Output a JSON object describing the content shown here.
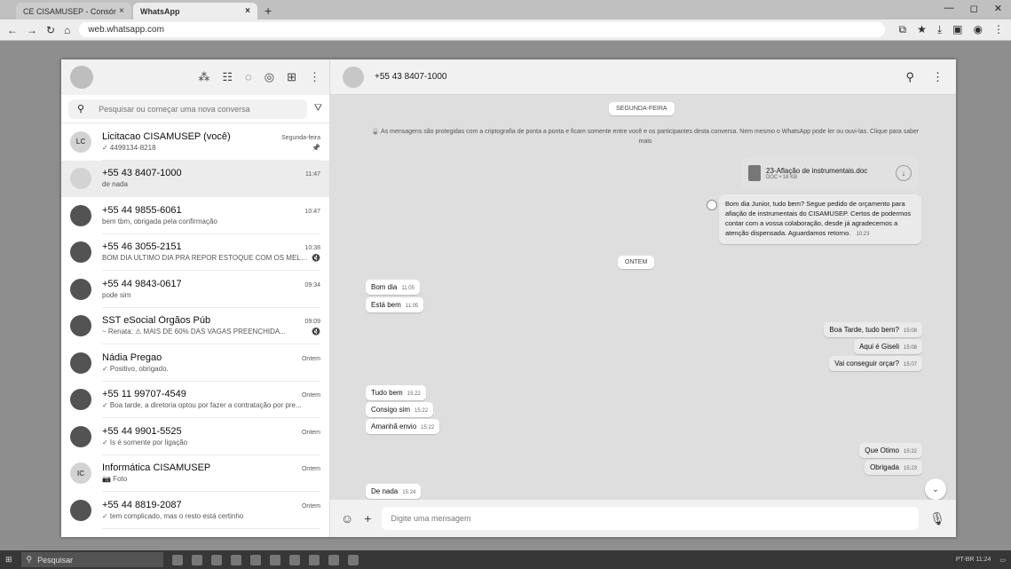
{
  "browser": {
    "tabs": [
      {
        "label": "CE CISAMUSEP - Consórcio Públi",
        "active": false
      },
      {
        "label": "WhatsApp",
        "active": true
      }
    ],
    "url": "web.whatsapp.com"
  },
  "sidebar": {
    "search_placeholder": "Pesquisar ou começar uma nova conversa",
    "chats": [
      {
        "name": "Licitacao CISAMUSEP (você)",
        "time": "Segunda-feira",
        "preview": "✓ 4499134-8218",
        "mark": "📌",
        "avatar": "light"
      },
      {
        "name": "+55 43 8407-1000",
        "time": "11:47",
        "preview": "de nada",
        "mark": "",
        "avatar": "light",
        "selected": true
      },
      {
        "name": "+55 44 9855-6061",
        "time": "10:47",
        "preview": "bem tbm, obrigada pela confirmação",
        "mark": "",
        "avatar": "dark"
      },
      {
        "name": "+55 46 3055-2151",
        "time": "10:38",
        "preview": "BOM DIA ULTIMO DIA PRA REPOR ESTOQUE COM OS MELH...",
        "mark": "🔇",
        "avatar": "dark"
      },
      {
        "name": "+55 44 9843-0617",
        "time": "09:34",
        "preview": "pode sim",
        "mark": "",
        "avatar": "dark"
      },
      {
        "name": "SST eSocial Órgãos Púb",
        "time": "09:09",
        "preview": "~ Renata: ⚠ MAIS DE 60% DAS VAGAS PREENCHIDA...",
        "mark": "🔇",
        "avatar": "dark"
      },
      {
        "name": "Nádia Pregao",
        "time": "Ontem",
        "preview": "✓ Positivo, obrigado.",
        "mark": "",
        "avatar": "dark"
      },
      {
        "name": "+55 11 99707-4549",
        "time": "Ontem",
        "preview": "✓ Boa tarde, a diretoria optou por fazer a contratação por pre...",
        "mark": "",
        "avatar": "dark"
      },
      {
        "name": "+55 44 9901-5525",
        "time": "Ontem",
        "preview": "✓ Is é somente por ligação",
        "mark": "",
        "avatar": "dark"
      },
      {
        "name": "Informática CISAMUSEP",
        "time": "Ontem",
        "preview": "📷 Foto",
        "mark": "",
        "avatar": "light"
      },
      {
        "name": "+55 44 8819-2087",
        "time": "Ontem",
        "preview": "✓ tem complicado, mas o resto está certinho",
        "mark": "",
        "avatar": "dark"
      }
    ]
  },
  "conversation": {
    "contact": "+55 43 8407-1000",
    "day_monday": "SEGUNDA-FEIRA",
    "day_yesterday": "ONTEM",
    "encryption_notice": "🔒 As mensagens são protegidas com a criptografia de ponta a ponta e ficam somente entre você e os participantes desta conversa. Nem mesmo o WhatsApp pode ler ou ouvi-las. Clique para saber mais",
    "doc": {
      "title": "23-Aflação de instrumentais.doc",
      "meta": "DOC • 18 KB"
    },
    "long_message": "Bom dia Junior, tudo bem? Segue pedido de orçamento para afiação de instrumentais do CISAMUSEP. Certos de podermos contar com a vossa colaboração, desde já agradecemos a atenção dispensada. Aguardamos retorno.",
    "long_time": "10:23",
    "messages": {
      "m1": {
        "text": "Bom dia",
        "time": "11:05"
      },
      "m2": {
        "text": "Está bem",
        "time": "11:05"
      },
      "m3": {
        "text": "Boa Tarde, tudo bem?",
        "time": "15:08"
      },
      "m4": {
        "text": "Aqui é Giseli",
        "time": "15:08"
      },
      "m5": {
        "text": "Vai conseguir orçar?",
        "time": "15:07"
      },
      "m6": {
        "text": "Tudo bem",
        "time": "15:22"
      },
      "m7": {
        "text": "Consigo sim",
        "time": "15:22"
      },
      "m8": {
        "text": "Amanhã envio",
        "time": "15:22"
      },
      "m9": {
        "text": "Que Otimo",
        "time": "15:22"
      },
      "m10": {
        "text": "Obrigada",
        "time": "15:23"
      },
      "m11": {
        "text": "De nada",
        "time": "15:24"
      }
    },
    "composer_placeholder": "Digite uma mensagem"
  },
  "taskbar": {
    "search": "Pesquisar",
    "tray": "PT-BR 11:24"
  }
}
